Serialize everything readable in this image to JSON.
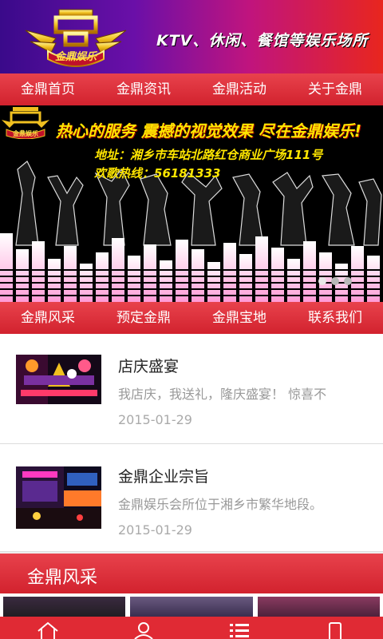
{
  "header": {
    "brand_text": "金鼎娱乐",
    "slogan": "KTV、休闲、餐馆等娱乐场所"
  },
  "nav_top": [
    {
      "label": "金鼎首页"
    },
    {
      "label": "金鼎资讯"
    },
    {
      "label": "金鼎活动"
    },
    {
      "label": "关于金鼎"
    }
  ],
  "banner": {
    "logo_text": "金鼎娱乐",
    "slogan": "热心的服务 震撼的视觉效果 尽在金鼎娱乐!",
    "address": "地址：湘乡市车站北路红仓商业广场111号",
    "hotline": "欢歌热线：56181333",
    "slides": 3,
    "active_slide": 1
  },
  "nav_mid": [
    {
      "label": "金鼎风采"
    },
    {
      "label": "预定金鼎"
    },
    {
      "label": "金鼎宝地"
    },
    {
      "label": "联系我们"
    }
  ],
  "news": [
    {
      "title": "店庆盛宴",
      "summary": "我店庆，我送礼，隆庆盛宴！ 惊喜不",
      "date": "2015-01-29"
    },
    {
      "title": "金鼎企业宗旨",
      "summary": "金鼎娱乐会所位于湘乡市繁华地段。",
      "date": "2015-01-29"
    }
  ],
  "section": {
    "title": "金鼎风采"
  },
  "tabbar": [
    {
      "icon": "home-icon"
    },
    {
      "icon": "user-icon"
    },
    {
      "icon": "list-icon"
    },
    {
      "icon": "phone-icon"
    }
  ],
  "colors": {
    "accent": "#d92a33",
    "banner_text": "#ffe600"
  }
}
